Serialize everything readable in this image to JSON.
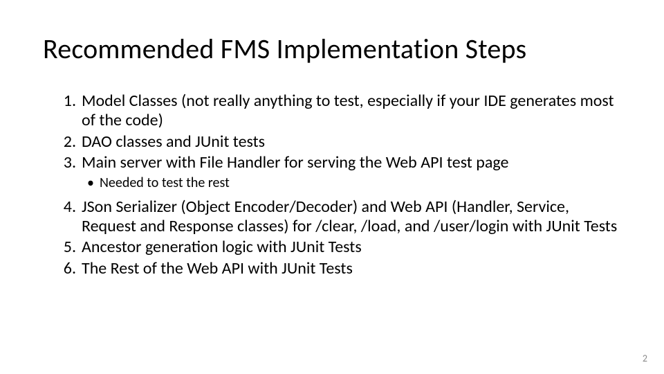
{
  "title": "Recommended FMS Implementation Steps",
  "steps": [
    {
      "text": "Model Classes (not really anything to test, especially if your IDE generates most of the code)",
      "sub": []
    },
    {
      "text": "DAO classes and JUnit tests",
      "sub": []
    },
    {
      "text": "Main server with File Handler for serving the Web API test page",
      "sub": [
        "Needed to test the rest"
      ]
    },
    {
      "text": "JSon Serializer (Object Encoder/Decoder) and Web API (Handler, Service, Request and Response classes) for /clear, /load, and /user/login with JUnit Tests",
      "sub": []
    },
    {
      "text": "Ancestor generation logic with JUnit Tests",
      "sub": []
    },
    {
      "text": "The Rest of the Web API with JUnit Tests",
      "sub": []
    }
  ],
  "page_number": "2"
}
